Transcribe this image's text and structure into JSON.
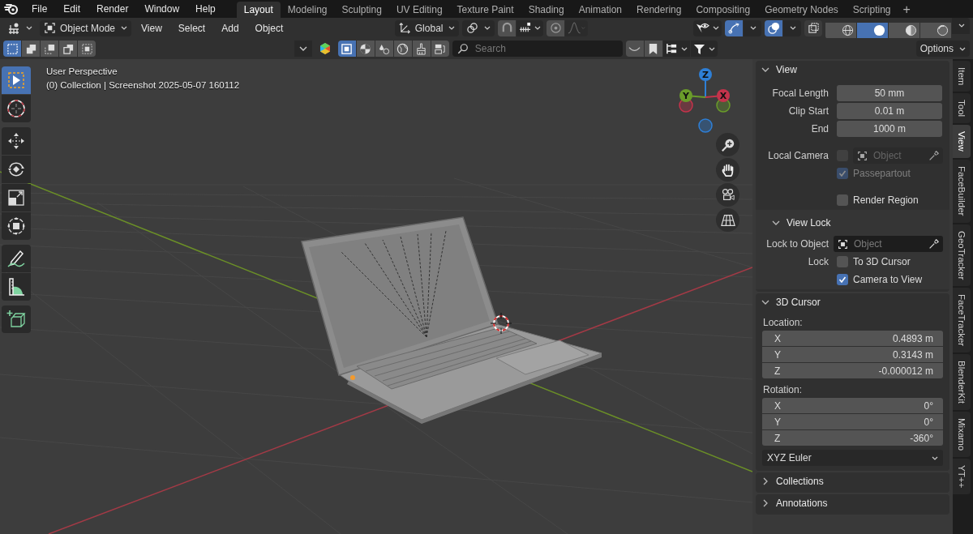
{
  "menu_bar": {
    "menus": [
      "File",
      "Edit",
      "Render",
      "Window",
      "Help"
    ],
    "workspaces": [
      {
        "label": "Layout",
        "selected": true
      },
      {
        "label": "Modeling",
        "selected": false
      },
      {
        "label": "Sculpting",
        "selected": false
      },
      {
        "label": "UV Editing",
        "selected": false
      },
      {
        "label": "Texture Paint",
        "selected": false
      },
      {
        "label": "Shading",
        "selected": false
      },
      {
        "label": "Animation",
        "selected": false
      },
      {
        "label": "Rendering",
        "selected": false
      },
      {
        "label": "Compositing",
        "selected": false
      },
      {
        "label": "Geometry Nodes",
        "selected": false
      },
      {
        "label": "Scripting",
        "selected": false
      }
    ],
    "add_workspace": "+"
  },
  "header": {
    "mode": "Object Mode",
    "menus": [
      "View",
      "Select",
      "Add",
      "Object"
    ],
    "orientation": "Global",
    "toggles": [
      {
        "kind": "gizmos",
        "on": true
      },
      {
        "kind": "overlays",
        "on": true
      },
      {
        "kind": "xray",
        "on": false
      }
    ],
    "shading": [
      {
        "kind": "wireframe",
        "selected": false
      },
      {
        "kind": "solid",
        "selected": true
      },
      {
        "kind": "material",
        "selected": false
      },
      {
        "kind": "rendered",
        "selected": false
      }
    ]
  },
  "tool_header": {
    "select_modes": [
      {
        "kind": "new",
        "selected": true
      },
      {
        "kind": "extend",
        "selected": false
      },
      {
        "kind": "subtract",
        "selected": false
      },
      {
        "kind": "invert",
        "selected": false
      },
      {
        "kind": "intersect",
        "selected": false
      }
    ],
    "filters": [
      {
        "kind": "object",
        "selected": true
      },
      {
        "kind": "material",
        "selected": false
      },
      {
        "kind": "texture",
        "selected": false
      },
      {
        "kind": "world",
        "selected": false
      },
      {
        "kind": "brush",
        "selected": false
      },
      {
        "kind": "node",
        "selected": false
      }
    ],
    "search": {
      "placeholder": "Search"
    },
    "options": "Options"
  },
  "viewport": {
    "view_name": "User Perspective",
    "info": "(0) Collection | Screenshot 2025-05-07 160112",
    "axes": [
      {
        "label": "Z",
        "color": "#2e7fd6"
      },
      {
        "label": "Y",
        "color": "#6a9c2a"
      },
      {
        "label": "X",
        "color": "#c4334b"
      }
    ],
    "tool_groups": [
      {
        "tools": [
          {
            "kind": "select_box",
            "selected": true
          },
          {
            "kind": "cursor",
            "selected": false
          }
        ]
      },
      {
        "tools": [
          {
            "kind": "move",
            "selected": false
          },
          {
            "kind": "rotate",
            "selected": false
          },
          {
            "kind": "scale",
            "selected": false
          },
          {
            "kind": "transform",
            "selected": false
          }
        ]
      },
      {
        "tools": [
          {
            "kind": "annotate",
            "selected": false
          },
          {
            "kind": "measure",
            "selected": false
          }
        ]
      },
      {
        "tools": [
          {
            "kind": "add_cube",
            "selected": false
          }
        ]
      }
    ]
  },
  "sidebar": {
    "panels": [
      {
        "title": "View",
        "expanded": true,
        "sections": [
          [
            {
              "kind": "number",
              "label": "Focal Length",
              "value": "50 mm"
            },
            {
              "kind": "number",
              "label": "Clip Start",
              "value": "0.01 m"
            },
            {
              "kind": "number",
              "label": "End",
              "value": "1000 m"
            }
          ],
          [
            {
              "kind": "object",
              "label": "Local Camera",
              "checked": false,
              "placeholder": "Object",
              "disabled": true
            },
            {
              "kind": "checkbox",
              "text": "Passepartout",
              "checked": true,
              "disabled": true
            }
          ],
          [
            {
              "kind": "checkbox",
              "text": "Render Region",
              "checked": false,
              "disabled": false
            }
          ]
        ],
        "subpanels": [
          {
            "title": "View Lock",
            "expanded": true,
            "sections": [
              [
                {
                  "kind": "object",
                  "label": "Lock to Object",
                  "placeholder": "Object",
                  "disabled": false
                },
                {
                  "kind": "checkbox",
                  "label": "Lock",
                  "text": "To 3D Cursor",
                  "checked": false,
                  "disabled": false
                },
                {
                  "kind": "checkbox",
                  "text": "Camera to View",
                  "checked": true,
                  "disabled": false
                }
              ]
            ]
          }
        ]
      },
      {
        "title": "3D Cursor",
        "expanded": true,
        "vectors": [
          {
            "label": "Location:",
            "items": [
              {
                "axis": "X",
                "value": "0.4893 m"
              },
              {
                "axis": "Y",
                "value": "0.3143 m"
              },
              {
                "axis": "Z",
                "value": "-0.000012 m"
              }
            ]
          },
          {
            "label": "Rotation:",
            "items": [
              {
                "axis": "X",
                "value": "0°"
              },
              {
                "axis": "Y",
                "value": "0°"
              },
              {
                "axis": "Z",
                "value": "-360°"
              }
            ]
          }
        ],
        "dropdown": "XYZ Euler"
      },
      {
        "title": "Collections",
        "expanded": false
      },
      {
        "title": "Annotations",
        "expanded": false
      }
    ],
    "tabs": [
      {
        "label": "Item",
        "selected": false
      },
      {
        "label": "Tool",
        "selected": false
      },
      {
        "label": "View",
        "selected": true
      },
      {
        "label": "FaceBuilder",
        "selected": false
      },
      {
        "label": "GeoTracker",
        "selected": false
      },
      {
        "label": "FaceTracker",
        "selected": false
      },
      {
        "label": "BlenderKit",
        "selected": false
      },
      {
        "label": "Mixamo",
        "selected": false
      },
      {
        "label": "YT++",
        "selected": false
      }
    ]
  }
}
